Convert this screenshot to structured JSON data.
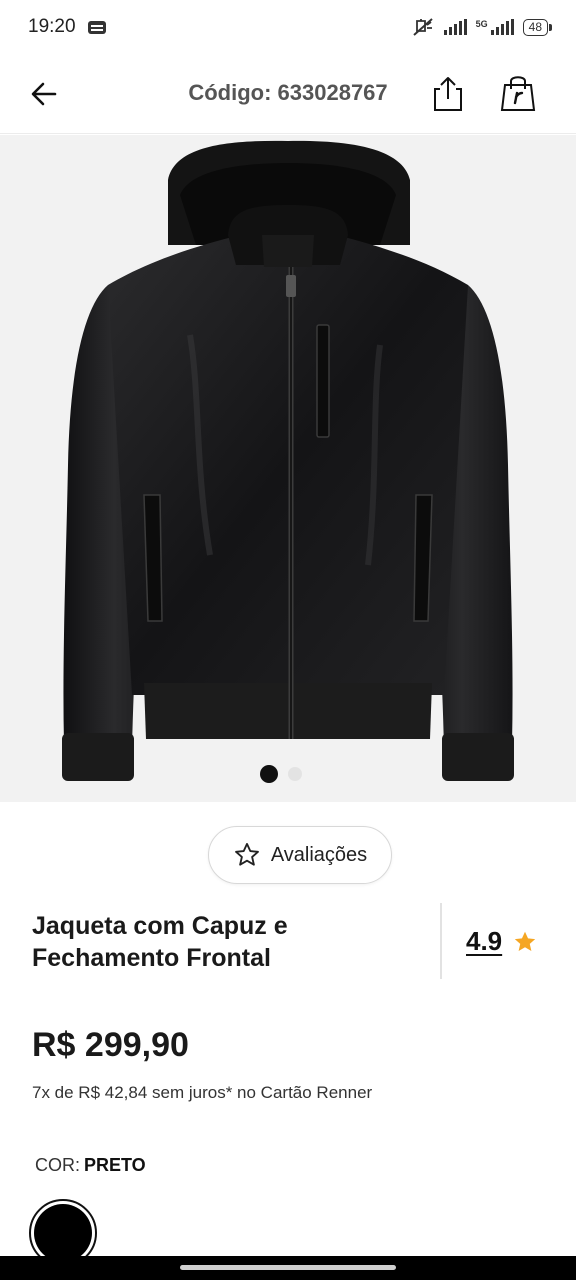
{
  "status_bar": {
    "time": "19:20",
    "network_label": "5G",
    "battery": "48",
    "icons": [
      "message-icon",
      "mute-icon",
      "signal-icon",
      "5g-signal-icon",
      "battery-icon"
    ]
  },
  "header": {
    "code_label": "Código: 633028767",
    "icons": [
      "back-arrow-icon",
      "share-icon",
      "shopping-bag-icon"
    ]
  },
  "gallery": {
    "image_alt_icon": "jacket-product-image",
    "total_images": 2,
    "active_index": 0
  },
  "reviews": {
    "button_label": "Avaliações",
    "icon": "star-outline-icon"
  },
  "product": {
    "title_line1": "Jaqueta com Capuz e",
    "title_line2": "Fechamento Frontal",
    "rating": "4.9",
    "rating_icon": "star-filled-icon",
    "rating_star_color": "#f5a623",
    "price": "R$ 299,90",
    "installments": "7x de R$ 42,84 sem juros* no Cartão Renner"
  },
  "color": {
    "label": "COR:",
    "value": "PRETO",
    "swatch_color": "#000000"
  }
}
